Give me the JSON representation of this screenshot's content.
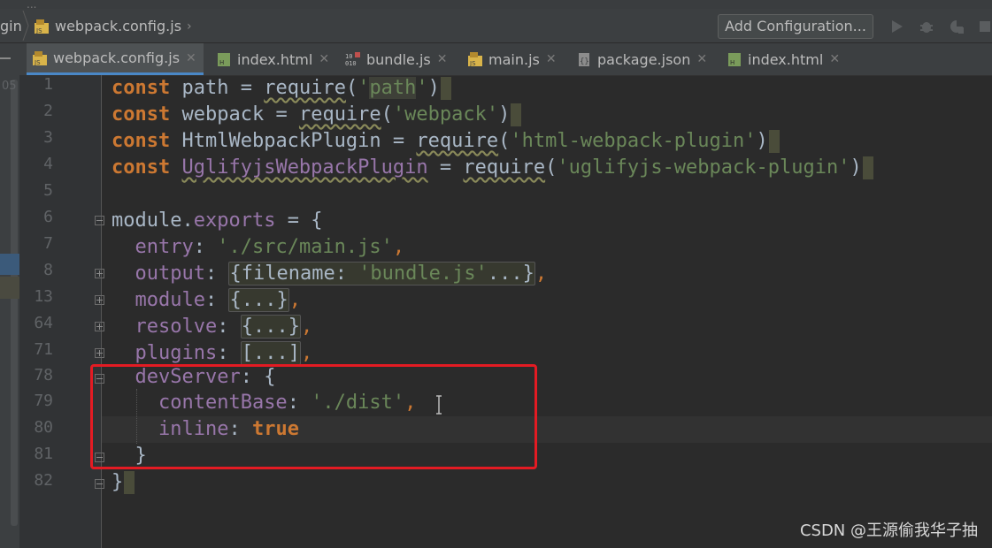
{
  "top_strip": "...",
  "breadcrumb": {
    "prev": "gin",
    "file": "webpack.config.js",
    "arrow": "›"
  },
  "toolbar": {
    "add_configuration": "Add Configuration...",
    "run_icon": "play-icon",
    "debug_icon": "bug-icon",
    "coverage_icon": "coverage-icon",
    "stop_icon": "stop-icon"
  },
  "tabs": [
    {
      "label": "webpack.config.js",
      "icon": "js-file-icon",
      "active": true
    },
    {
      "label": "index.html",
      "icon": "html-file-icon",
      "active": false
    },
    {
      "label": "bundle.js",
      "icon": "binary-file-icon",
      "active": false
    },
    {
      "label": "main.js",
      "icon": "js-file-icon",
      "active": false
    },
    {
      "label": "package.json",
      "icon": "json-file-icon",
      "active": false
    },
    {
      "label": "index.html",
      "icon": "html-file-icon",
      "active": false
    }
  ],
  "left_stripe_number": "05",
  "line_numbers": [
    "1",
    "2",
    "3",
    "4",
    "5",
    "6",
    "7",
    "8",
    "13",
    "64",
    "71",
    "78",
    "79",
    "80",
    "81",
    "82"
  ],
  "code": {
    "l1": {
      "kw": "const",
      "name": " path ",
      "eq": "= ",
      "fn": "require",
      "open": "(",
      "q1": "'",
      "str": "path",
      "q2": "'",
      "close": ")"
    },
    "l2": {
      "kw": "const",
      "name": " webpack ",
      "eq": "= ",
      "fn": "require",
      "open": "(",
      "str": "'webpack'",
      "close": ")"
    },
    "l3": {
      "kw": "const",
      "name": " HtmlWebpackPlugin ",
      "eq": "= ",
      "fn": "require",
      "open": "(",
      "str": "'html-webpack-plugin'",
      "close": ")"
    },
    "l4": {
      "kw": "const",
      "sp": " ",
      "name": "UglifyjsWebpackPlugin",
      "eq": " = ",
      "fn": "require",
      "open": "(",
      "str": "'uglifyjs-webpack-plugin'",
      "close": ")"
    },
    "l6": {
      "obj": "module",
      "dot": ".",
      "prop": "exports",
      "rest": " = {"
    },
    "l7": {
      "indent": "  ",
      "key": "entry",
      "colon": ": ",
      "str": "'./src/main.js'",
      "comma": ","
    },
    "l8": {
      "indent": "  ",
      "key": "output",
      "colon": ": ",
      "open": "{",
      "inner": "filename: ",
      "str": "'bundle.js'",
      "ell": "...",
      "close": "}",
      "comma": ","
    },
    "l13": {
      "indent": "  ",
      "key": "module",
      "colon": ": ",
      "fold": "{...}",
      "comma": ","
    },
    "l64": {
      "indent": "  ",
      "key": "resolve",
      "colon": ": ",
      "fold": "{...}",
      "comma": ","
    },
    "l71": {
      "indent": "  ",
      "key": "plugins",
      "colon": ": ",
      "fold": "[...]",
      "comma": ","
    },
    "l78": {
      "indent": "  ",
      "key": "devServer",
      "colon": ": ",
      "rest": "{"
    },
    "l79": {
      "indent": "    ",
      "key": "contentBase",
      "colon": ": ",
      "str": "'./dist'",
      "comma": ","
    },
    "l80": {
      "indent": "    ",
      "key": "inline",
      "colon": ": ",
      "kw": "true"
    },
    "l81": {
      "indent": "  ",
      "rest": "}"
    },
    "l82": {
      "rest": "}"
    }
  },
  "watermark": "CSDN @王源偷我华子抽",
  "colors": {
    "keyword": "#cc7832",
    "string": "#6a8759",
    "property": "#9876aa",
    "text": "#a9b7c6",
    "highlight_box": "#e31b23",
    "active_tab_underline": "#4a88c7"
  }
}
